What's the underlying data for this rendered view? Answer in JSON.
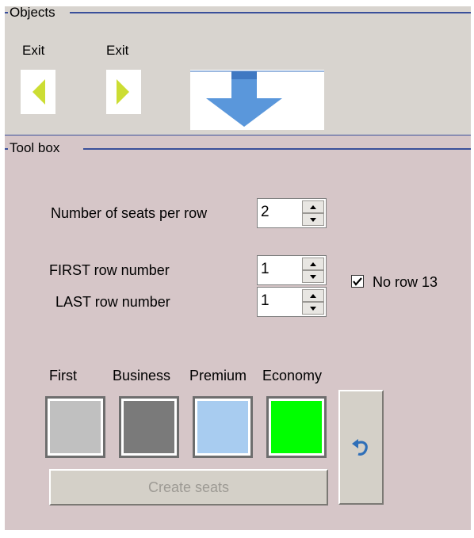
{
  "objects": {
    "title": "Objects",
    "exit_left_label": "Exit",
    "exit_right_label": "Exit"
  },
  "toolbox": {
    "title": "Tool box",
    "seats_per_row_label": "Number of seats per row",
    "seats_per_row_value": "2",
    "first_row_label": "FIRST row number",
    "first_row_value": "1",
    "last_row_label": "LAST row number",
    "last_row_value": "1",
    "no_row_13_label": "No row 13",
    "no_row_13_checked": true,
    "classes": [
      {
        "label": "First",
        "color": "#c0c0c0"
      },
      {
        "label": "Business",
        "color": "#7a7a7a"
      },
      {
        "label": "Premium",
        "color": "#a8ccf0"
      },
      {
        "label": "Economy",
        "color": "#00ff00"
      }
    ],
    "create_seats_label": "Create seats",
    "undo_icon": "undo-icon"
  },
  "colors": {
    "objects_bg": "#d8d4cf",
    "toolbox_bg": "#d6c6c8",
    "group_line": "#3a4f9a",
    "exit_arrow": "#ccdd33",
    "big_arrow": "#4a90d9"
  }
}
